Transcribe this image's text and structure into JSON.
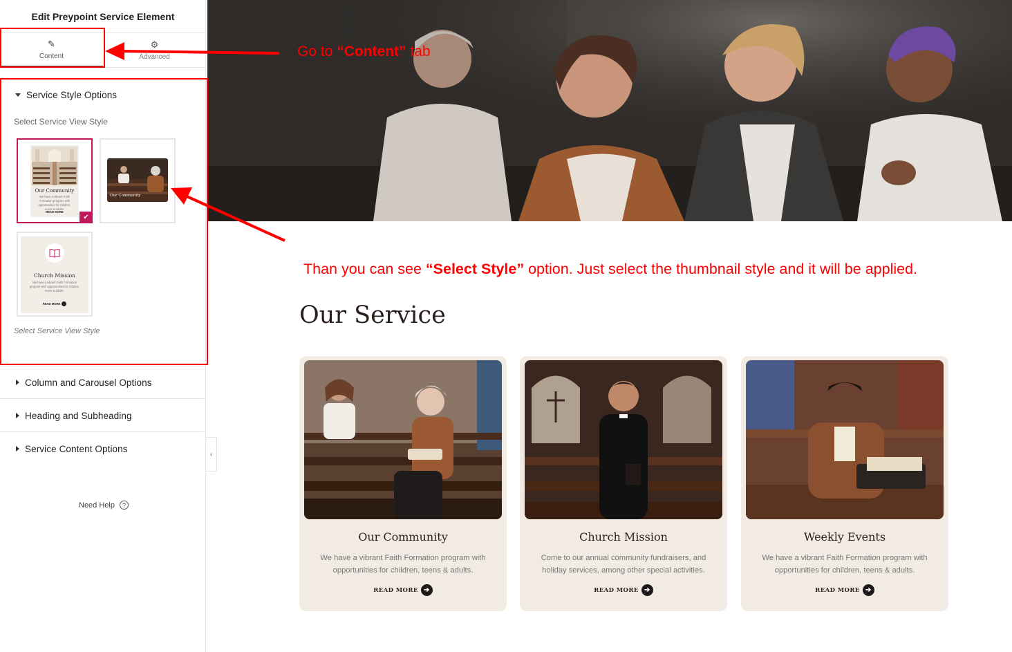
{
  "sidebar": {
    "title": "Edit Preypoint Service Element",
    "tabs": [
      {
        "label": "Content",
        "icon": "pencil-icon"
      },
      {
        "label": "Advanced",
        "icon": "gear-icon"
      }
    ],
    "style_section": {
      "heading": "Service Style Options",
      "field_label": "Select Service View Style",
      "field_hint": "Select Service View Style",
      "thumbnails": [
        {
          "title": "Our Community",
          "text": "We have a vibrant Faith Formation program with opportunities for children, teens & adults.",
          "more": "READ MORE",
          "selected": true
        },
        {
          "title": "Our Community",
          "selected": false
        },
        {
          "title": "Church Mission",
          "text": "We have a vibrant Faith Formation program with opportunities for children, teens & adults.",
          "more": "READ MORE",
          "selected": false
        }
      ]
    },
    "sections": [
      {
        "label": "Column and Carousel Options"
      },
      {
        "label": "Heading and Subheading"
      },
      {
        "label": "Service Content Options"
      }
    ],
    "help": "Need Help"
  },
  "annotations": {
    "content_tab_note": {
      "pre": "Go  to ",
      "bold": "“Content”",
      "post": " tab"
    },
    "select_style_note": {
      "pre": "Than you can see ",
      "bold": "“Select Style”",
      "post": " option. Just select the thumbnail style and it will be applied."
    },
    "color": "#ff0000"
  },
  "main": {
    "section_title": "Our Service",
    "cards": [
      {
        "title": "Our Community",
        "text": "We have a vibrant Faith Formation program with opportunities for children, teens & adults.",
        "more": "READ MORE"
      },
      {
        "title": "Church Mission",
        "text": "Come to our annual community fundraisers, and holiday services, among other special activities.",
        "more": "READ MORE"
      },
      {
        "title": "Weekly Events",
        "text": "We have a vibrant Faith Formation program with opportunities for children, teens & adults.",
        "more": "READ MORE"
      }
    ]
  },
  "colors": {
    "accent": "#c2185b",
    "card_bg": "#f1ebe3",
    "heading": "#2a1f1d"
  }
}
